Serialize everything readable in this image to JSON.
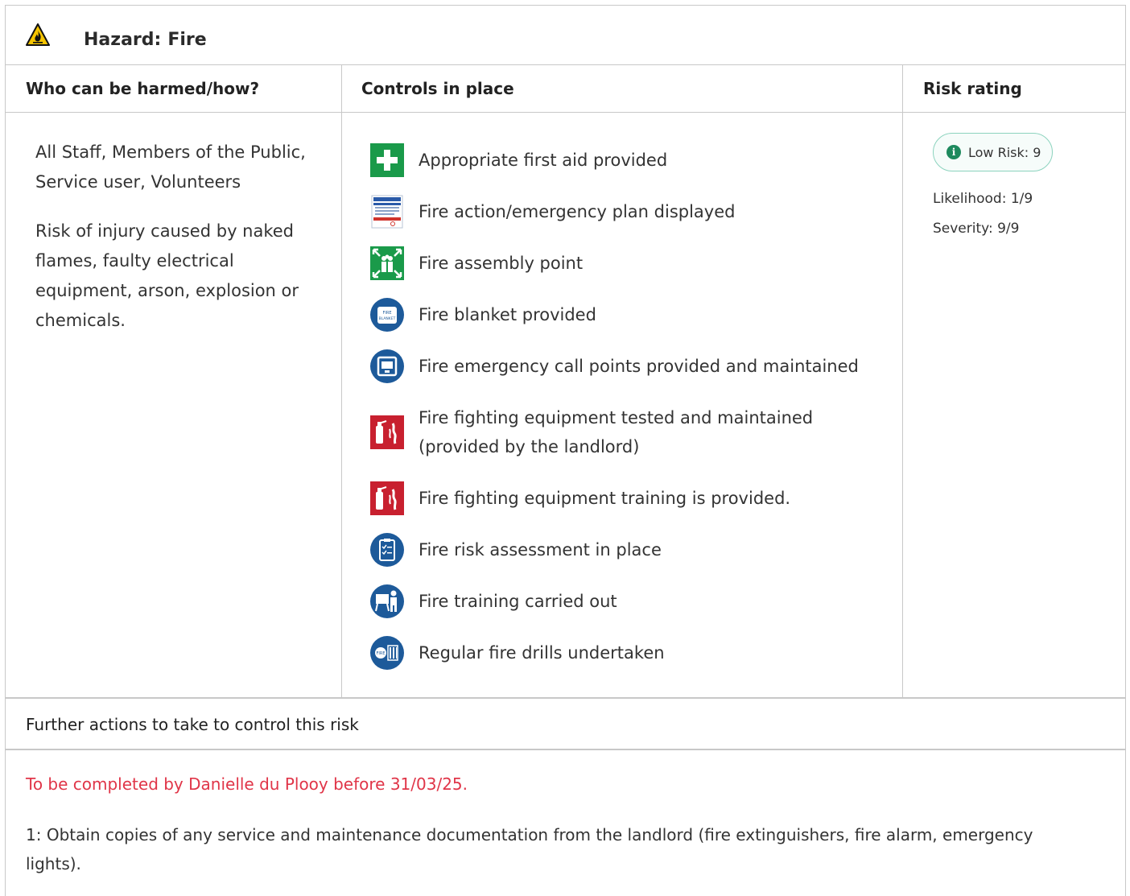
{
  "hazard": {
    "label": "Hazard:",
    "name": "Fire",
    "icon": "fire-hazard-warning-icon"
  },
  "columns": {
    "who": "Who can be harmed/how?",
    "controls": "Controls in place",
    "risk": "Risk rating"
  },
  "who": {
    "people": "All Staff, Members of the Public, Service user, Volunteers",
    "how": "Risk of injury caused by naked flames, faulty electrical equipment, arson, explosion or chemicals."
  },
  "controls": [
    {
      "label": "Appropriate first aid provided",
      "icon": "first-aid-icon"
    },
    {
      "label": "Fire action/emergency plan displayed",
      "icon": "fire-action-notice-icon"
    },
    {
      "label": "Fire assembly point",
      "icon": "assembly-point-icon"
    },
    {
      "label": "Fire blanket provided",
      "icon": "fire-blanket-icon"
    },
    {
      "label": "Fire emergency call points provided and maintained",
      "icon": "call-point-icon"
    },
    {
      "label": "Fire fighting equipment tested and maintained (provided by the landlord)",
      "icon": "fire-extinguisher-icon"
    },
    {
      "label": "Fire fighting equipment training is provided.",
      "icon": "fire-extinguisher-icon"
    },
    {
      "label": "Fire risk assessment in place",
      "icon": "risk-assessment-clipboard-icon"
    },
    {
      "label": "Fire training carried out",
      "icon": "training-presentation-icon"
    },
    {
      "label": "Regular fire drills undertaken",
      "icon": "fire-drill-icon"
    }
  ],
  "risk": {
    "badge": "Low Risk: 9",
    "likelihood": "Likelihood: 1/9",
    "severity": "Severity: 9/9",
    "color": "#1e8a5e"
  },
  "further": {
    "heading": "Further actions to take to control this risk",
    "due": "To be completed by Danielle du Plooy before 31/03/25.",
    "action": "1: Obtain copies of any service and maintenance documentation from the landlord (fire extinguishers, fire alarm, emergency lights)."
  }
}
